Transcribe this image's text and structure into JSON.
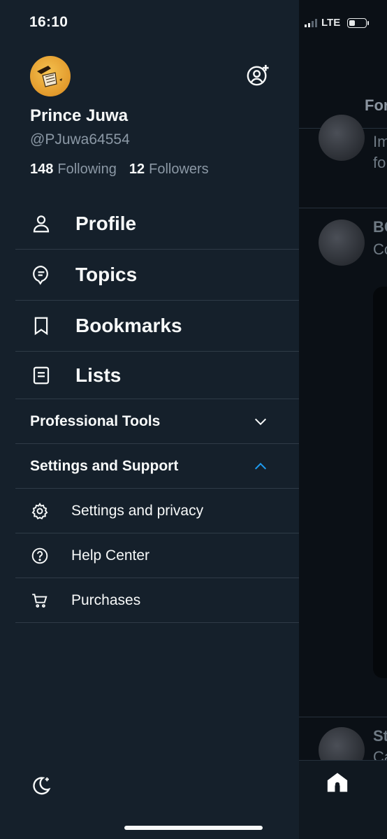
{
  "status_bar": {
    "time": "16:10",
    "network": "LTE"
  },
  "profile": {
    "name": "Prince Juwa",
    "handle": "@PJuwa64554",
    "following_count": "148",
    "following_label": "Following",
    "followers_count": "12",
    "followers_label": "Followers"
  },
  "nav": [
    {
      "label": "Profile",
      "icon": "person-icon"
    },
    {
      "label": "Topics",
      "icon": "topics-icon"
    },
    {
      "label": "Bookmarks",
      "icon": "bookmark-icon"
    },
    {
      "label": "Lists",
      "icon": "list-icon"
    }
  ],
  "sections": {
    "professional_tools": {
      "label": "Professional Tools",
      "state": "collapsed"
    },
    "settings_support": {
      "label": "Settings and Support",
      "state": "expanded"
    }
  },
  "settings_items": [
    {
      "label": "Settings and privacy",
      "icon": "gear-icon"
    },
    {
      "label": "Help Center",
      "icon": "help-icon"
    },
    {
      "label": "Purchases",
      "icon": "cart-icon"
    }
  ],
  "background": {
    "tab_label": "For",
    "post1_text": "Im",
    "post1_text2": "fo",
    "post2_author": "BC",
    "post2_text": "Co",
    "post3_author": "St",
    "post3_text": "Ca"
  },
  "colors": {
    "accent": "#1d9bf0",
    "drawer_bg": "#15202b",
    "divider": "#2f3b47",
    "secondary_text": "#8b98a5"
  }
}
